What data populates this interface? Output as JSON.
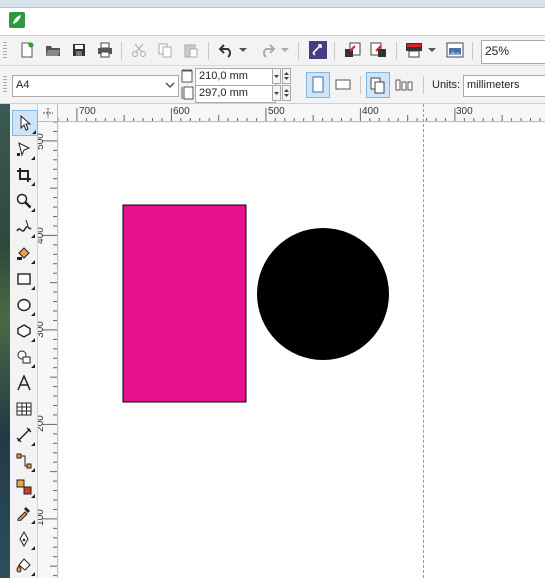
{
  "document": {
    "page_size": "A4",
    "width": "210,0 mm",
    "height": "297,0 mm"
  },
  "toolbar": {
    "zoom": "25%"
  },
  "property_bar": {
    "units_label": "Units:",
    "units_value": "millimeters"
  },
  "rulers": {
    "top_labels": [
      "700",
      "600",
      "500",
      "400",
      "300"
    ],
    "left_labels": [
      "500",
      "400",
      "300",
      "200",
      "100"
    ]
  },
  "colors": {
    "rectangle_fill": "#e8108e",
    "circle_fill": "#000000"
  },
  "icons": {
    "standard_toolbar": [
      "new-document-icon",
      "open-icon",
      "save-icon",
      "print-icon",
      "cut-icon",
      "copy-icon",
      "paste-icon",
      "undo-icon",
      "redo-icon",
      "launcher-icon",
      "import-icon",
      "export-icon",
      "publish-pdf-icon",
      "view-manager-icon"
    ],
    "toolbox": [
      "pick-tool-icon",
      "shape-tool-icon",
      "crop-tool-icon",
      "zoom-tool-icon",
      "freehand-tool-icon",
      "smart-fill-icon",
      "rectangle-tool-icon",
      "ellipse-tool-icon",
      "polygon-tool-icon",
      "basic-shapes-icon",
      "text-tool-icon",
      "table-tool-icon",
      "dimension-tool-icon",
      "connector-tool-icon",
      "blend-tool-icon",
      "eyedropper-tool-icon",
      "outline-pen-icon",
      "fill-tool-icon"
    ]
  }
}
